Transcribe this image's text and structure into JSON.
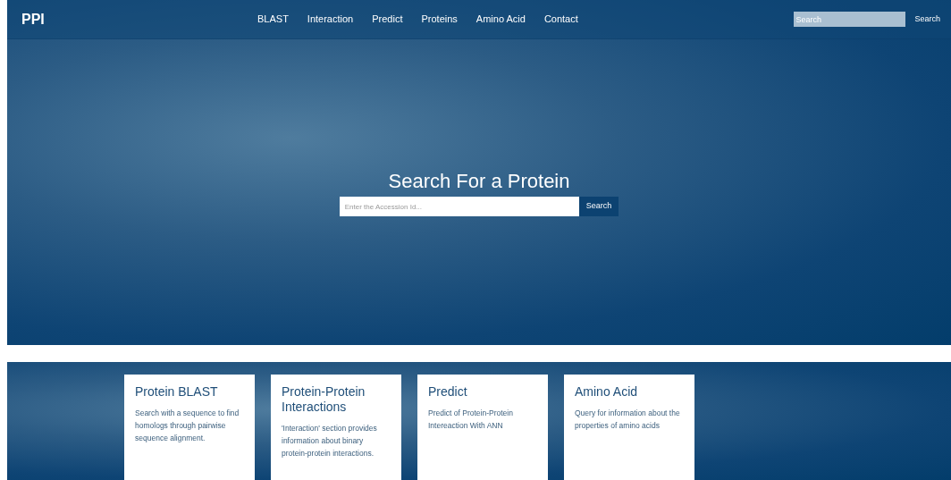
{
  "brand": "PPI",
  "nav": [
    "BLAST",
    "Interaction",
    "Predict",
    "Proteins",
    "Amino Acid",
    "Contact"
  ],
  "nav_search": {
    "placeholder": "Search",
    "button": "Search"
  },
  "hero": {
    "title": "Search For a Protein",
    "placeholder": "Enter the Accession Id...",
    "button": "Search"
  },
  "cards": [
    {
      "title": "Protein BLAST",
      "text": "Search with a sequence to find homologs through pairwise sequence alignment."
    },
    {
      "title": "Protein-Protein Interactions",
      "text": "'Interaction' section provides information about binary protein-protein interactions."
    },
    {
      "title": "Predict",
      "text": "Predict of Protein-Protein Intereaction With ANN"
    },
    {
      "title": "Amino Acid",
      "text": "Query for information about the properties of amino acids"
    }
  ]
}
